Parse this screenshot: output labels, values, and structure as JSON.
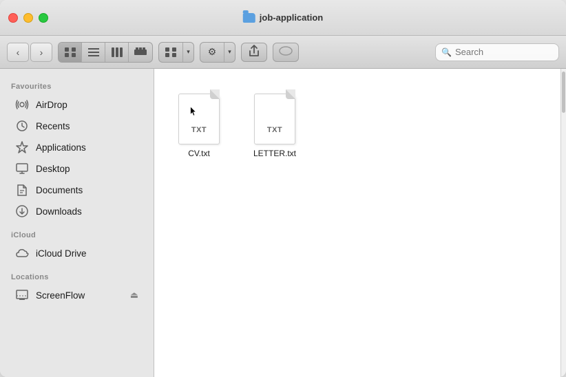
{
  "window": {
    "title": "job-application"
  },
  "toolbar": {
    "search_placeholder": "Search"
  },
  "sidebar": {
    "favourites_label": "Favourites",
    "icloud_label": "iCloud",
    "locations_label": "Locations",
    "items": [
      {
        "id": "airdrop",
        "label": "AirDrop",
        "icon": "📡"
      },
      {
        "id": "recents",
        "label": "Recents",
        "icon": "🕐"
      },
      {
        "id": "applications",
        "label": "Applications",
        "icon": "🚀"
      },
      {
        "id": "desktop",
        "label": "Desktop",
        "icon": "🖥"
      },
      {
        "id": "documents",
        "label": "Documents",
        "icon": "📄"
      },
      {
        "id": "downloads",
        "label": "Downloads",
        "icon": "⬇"
      }
    ],
    "icloud_items": [
      {
        "id": "icloud-drive",
        "label": "iCloud Drive",
        "icon": "☁"
      }
    ],
    "location_items": [
      {
        "id": "screenflow",
        "label": "ScreenFlow",
        "icon": "💾",
        "eject": "⏏"
      }
    ]
  },
  "files": [
    {
      "id": "cv-txt",
      "name": "CV.txt",
      "type": "TXT"
    },
    {
      "id": "letter-txt",
      "name": "LETTER.txt",
      "type": "TXT"
    }
  ],
  "nav": {
    "back_label": "‹",
    "forward_label": "›"
  }
}
